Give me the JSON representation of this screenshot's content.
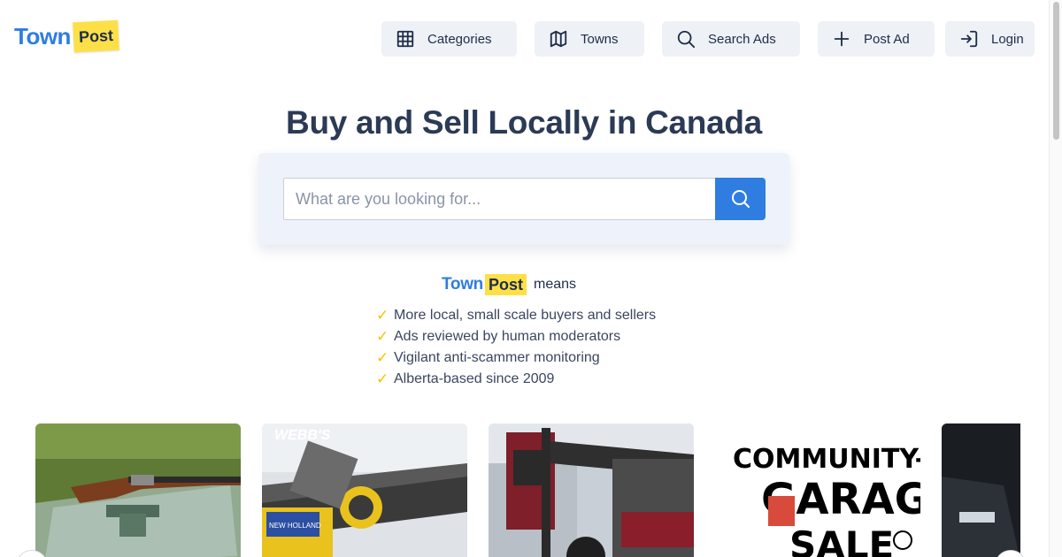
{
  "brand": {
    "town": "Town",
    "post": "Post"
  },
  "nav": {
    "categories": "Categories",
    "towns": "Towns",
    "search_ads": "Search Ads",
    "post_ad": "Post Ad",
    "login": "Login"
  },
  "hero": {
    "title": "Buy and Sell Locally in Canada",
    "search_placeholder": "What are you looking for..."
  },
  "means": {
    "town": "Town",
    "post": "Post",
    "word": "means",
    "items": [
      "More local, small scale buyers and sellers",
      "Ads reviewed by human moderators",
      "Vigilant anti-scammer monitoring",
      "Alberta-based since 2009"
    ],
    "tick": "✓"
  },
  "listings": [
    {
      "image": "shotgun-on-shooting-rest"
    },
    {
      "image": "new-holland-swather-header",
      "photo_text": "WEBB'S",
      "decal_text": "NEW HOLLAND"
    },
    {
      "image": "red-farm-sprayer"
    },
    {
      "image": "community-garage-sale-poster",
      "poster_line1": "COMMUNITY-W",
      "poster_line2": "GARAG",
      "poster_line3": "SALE"
    },
    {
      "image": "black-car"
    }
  ],
  "colors": {
    "brand_blue": "#2f7de1",
    "brand_yellow": "#fde047",
    "text_dark": "#2b3a55",
    "nav_bg": "#eef1f6"
  }
}
